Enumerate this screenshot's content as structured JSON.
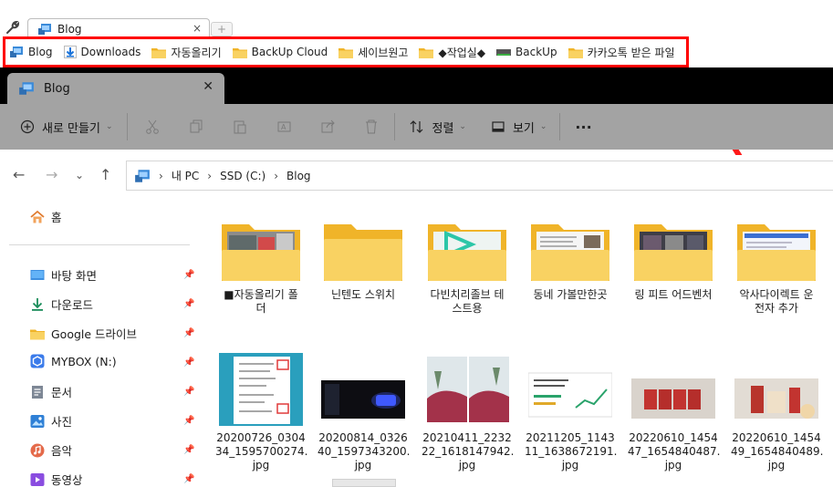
{
  "browser": {
    "tab_title": "Blog",
    "tab_close": "×",
    "new_tab": "+"
  },
  "bookmarks": [
    {
      "label": "Blog",
      "icon": "explorer-icon"
    },
    {
      "label": "Downloads",
      "icon": "download-icon"
    },
    {
      "label": "자동올리기",
      "icon": "folder-icon"
    },
    {
      "label": "BackUp Cloud",
      "icon": "folder-icon"
    },
    {
      "label": "세이브원고",
      "icon": "folder-icon"
    },
    {
      "label": "◆작업실◆",
      "icon": "folder-icon"
    },
    {
      "label": "BackUp",
      "icon": "drive-icon"
    },
    {
      "label": "카카오톡 받은 파일",
      "icon": "folder-icon"
    }
  ],
  "explorer": {
    "tab_title": "Blog",
    "tab_close": "✕"
  },
  "ribbon": {
    "new_label": "새로 만들기",
    "sort_label": "정렬",
    "view_label": "보기",
    "more": "···"
  },
  "address": {
    "segments": [
      "내 PC",
      "SSD (C:)",
      "Blog"
    ],
    "separator": "›"
  },
  "sidebar": {
    "home": "홈",
    "items": [
      {
        "label": "바탕 화면",
        "icon": "desktop-icon"
      },
      {
        "label": "다운로드",
        "icon": "download-icon"
      },
      {
        "label": "Google 드라이브",
        "icon": "folder-icon"
      },
      {
        "label": "MYBOX (N:)",
        "icon": "mybox-icon"
      },
      {
        "label": "문서",
        "icon": "document-icon"
      },
      {
        "label": "사진",
        "icon": "pictures-icon"
      },
      {
        "label": "음악",
        "icon": "music-icon"
      },
      {
        "label": "동영상",
        "icon": "video-icon"
      }
    ]
  },
  "folders": [
    {
      "line1": "■자동올리기 폴",
      "line2": "더"
    },
    {
      "line1": "닌텐도 스위치",
      "line2": ""
    },
    {
      "line1": "다빈치리졸브 테",
      "line2": "스트용"
    },
    {
      "line1": "동네 가볼만한곳",
      "line2": ""
    },
    {
      "line1": "링 피트 어드벤처",
      "line2": ""
    },
    {
      "line1": "악사다이렉트 운",
      "line2": "전자 추가"
    }
  ],
  "files": [
    {
      "line1": "20200726_0304",
      "line2": "34_1595700274.",
      "line3": "jpg"
    },
    {
      "line1": "20200814_0326",
      "line2": "40_1597343200.",
      "line3": "jpg"
    },
    {
      "line1": "20210411_2232",
      "line2": "22_1618147942.",
      "line3": "jpg"
    },
    {
      "line1": "20211205_1143",
      "line2": "11_1638672191.",
      "line3": "jpg"
    },
    {
      "line1": "20220610_1454",
      "line2": "47_1654840487.",
      "line3": "jpg"
    },
    {
      "line1": "20220610_1454",
      "line2": "49_1654840489.",
      "line3": "jpg"
    }
  ],
  "colors": {
    "highlight_border": "#ff0000",
    "ribbon_bg": "#a3a3a3",
    "folder": "#f7c948"
  }
}
